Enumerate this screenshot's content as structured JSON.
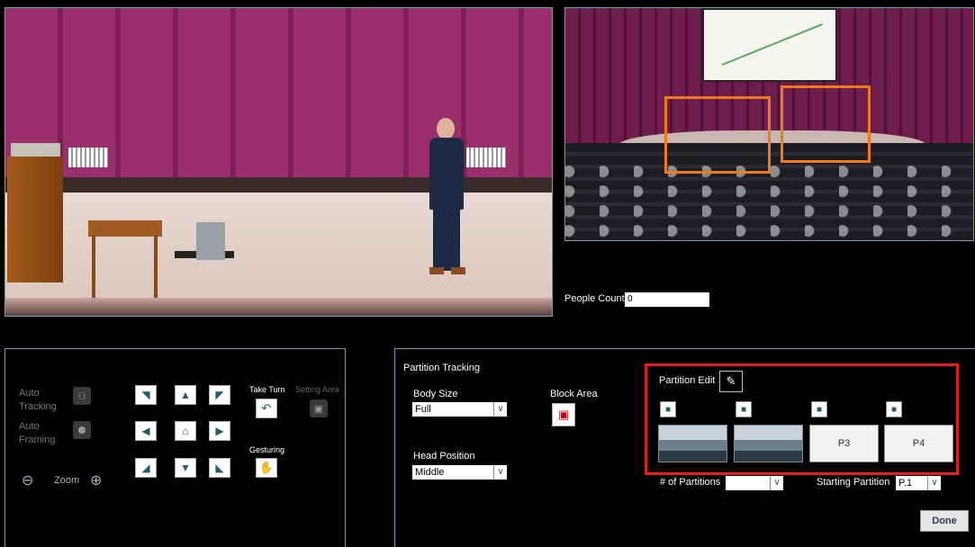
{
  "main_video": {
    "alt": ""
  },
  "preview": {},
  "people_count": {
    "label": "People Count",
    "value": "0"
  },
  "controls": {
    "auto_tracking_label": "Auto\nTracking",
    "auto_framing_label": "Auto\nFraming",
    "zoom_label": "Zoom",
    "take_turn_label": "Take Turn",
    "setting_area_label": "Setting Area",
    "gesturing_label": "Gesturing"
  },
  "partition": {
    "title": "Partition Tracking",
    "body_size_label": "Body Size",
    "body_size_value": "Full",
    "head_position_label": "Head Position",
    "head_position_value": "Middle",
    "block_area_label": "Block Area",
    "partition_edit_label": "Partition Edit",
    "thumbs": [
      "",
      "",
      "P3",
      "P4"
    ],
    "num_partitions_label": "# of Partitions",
    "num_partitions_value": "",
    "starting_partition_label": "Starting Partition",
    "starting_partition_value": "P.1",
    "done_label": "Done"
  },
  "colors": {
    "accent": "#6aa3b4",
    "highlight": "#e01e1e",
    "roi": "#f07a1a"
  }
}
